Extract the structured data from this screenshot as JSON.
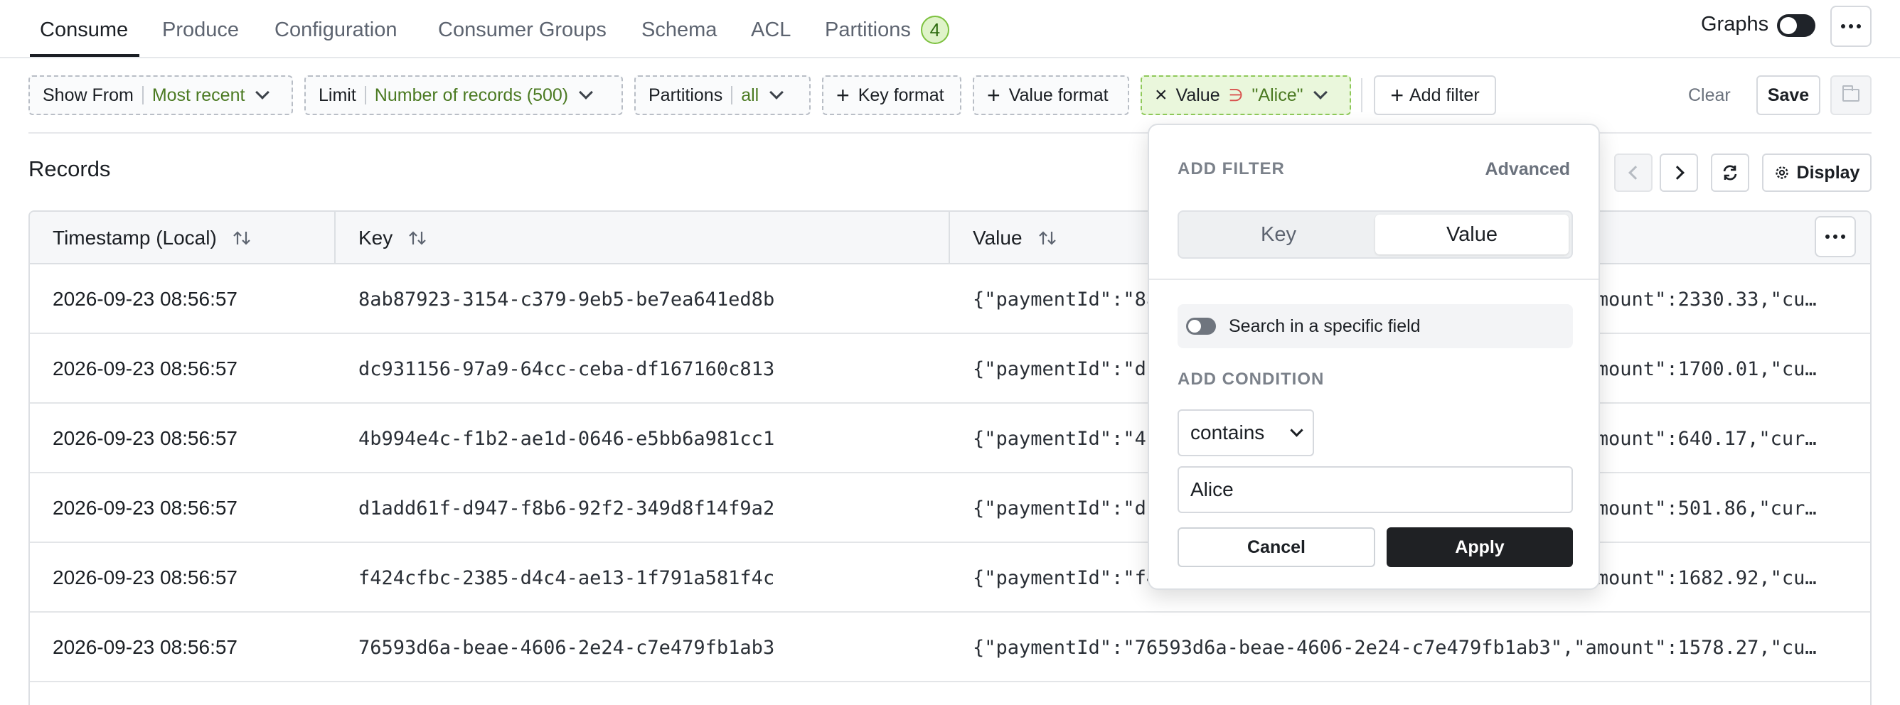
{
  "tabs": [
    {
      "label": "Consume",
      "active": true
    },
    {
      "label": "Produce"
    },
    {
      "label": "Configuration"
    },
    {
      "label": "Consumer Groups"
    },
    {
      "label": "Schema"
    },
    {
      "label": "ACL"
    },
    {
      "label": "Partitions",
      "badge": "4"
    }
  ],
  "header": {
    "graphs_label": "Graphs",
    "more_icon": "ellipsis-icon"
  },
  "filters": {
    "show_from": {
      "label": "Show From",
      "value": "Most recent"
    },
    "limit": {
      "label": "Limit",
      "value": "Number of records (500)"
    },
    "partitions": {
      "label": "Partitions",
      "value": "all"
    },
    "key_format": "Key format",
    "value_format": "Value format",
    "active_filter": {
      "field": "Value",
      "operator": "∋",
      "value": "\"Alice\""
    },
    "add_filter": "Add filter",
    "clear": "Clear",
    "save": "Save"
  },
  "records": {
    "title": "Records",
    "display_label": "Display",
    "columns": [
      "Timestamp (Local)",
      "Key",
      "Value"
    ],
    "rows": [
      {
        "ts": "2026-09-23 08:56:57",
        "key": "8ab87923-3154-c379-9eb5-be7ea641ed8b",
        "value": "{\"paymentId\":\"8ab87923-3154-c379-9eb5-be7ea641ed8b\",\"amount\":2330.33,\"cu…"
      },
      {
        "ts": "2026-09-23 08:56:57",
        "key": "dc931156-97a9-64cc-ceba-df167160c813",
        "value": "{\"paymentId\":\"dc931156-97a9-64cc-ceba-df167160c813\",\"amount\":1700.01,\"cu…"
      },
      {
        "ts": "2026-09-23 08:56:57",
        "key": "4b994e4c-f1b2-ae1d-0646-e5bb6a981cc1",
        "value": "{\"paymentId\":\"4b994e4c-f1b2-ae1d-0646-e5bb6a981cc1\",\"amount\":640.17,\"cur…"
      },
      {
        "ts": "2026-09-23 08:56:57",
        "key": "d1add61f-d947-f8b6-92f2-349d8f14f9a2",
        "value": "{\"paymentId\":\"d1add61f-d947-f8b6-92f2-349d8f14f9a2\",\"amount\":501.86,\"cur…"
      },
      {
        "ts": "2026-09-23 08:56:57",
        "key": "f424cfbc-2385-d4c4-ae13-1f791a581f4c",
        "value": "{\"paymentId\":\"f424cfbc-2385-d4c4-ae13-1f791a581f4c\",\"amount\":1682.92,\"cu…"
      },
      {
        "ts": "2026-09-23 08:56:57",
        "key": "76593d6a-beae-4606-2e24-c7e479fb1ab3",
        "value": "{\"paymentId\":\"76593d6a-beae-4606-2e24-c7e479fb1ab3\",\"amount\":1578.27,\"cu…"
      }
    ]
  },
  "popover": {
    "title": "ADD FILTER",
    "advanced": "Advanced",
    "segment": {
      "options": [
        "Key",
        "Value"
      ],
      "selected": "Value"
    },
    "specific_field_label": "Search in a specific field",
    "condition_title": "ADD CONDITION",
    "condition_operator": "contains",
    "condition_value": "Alice",
    "cancel": "Cancel",
    "apply": "Apply"
  },
  "colors": {
    "accent_green": "#7cc13e",
    "primary_dark": "#1f2124",
    "active_chip_bg": "#eaf7dc"
  }
}
